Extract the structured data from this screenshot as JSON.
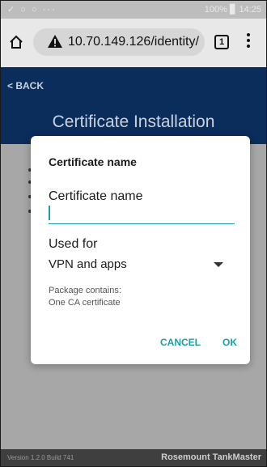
{
  "statusbar": {
    "left": "✓ ○ ○ ···",
    "right": "100% ▊ 14:25"
  },
  "browser": {
    "url": "10.70.149.126/identity/",
    "tab_count": "1",
    "icons": [
      "home-icon",
      "warning-icon",
      "overflow-menu-icon"
    ]
  },
  "app": {
    "back_label": "< BACK",
    "title": "Certificate Installation"
  },
  "dialog": {
    "title": "Certificate name",
    "name_label": "Certificate name",
    "name_value": "",
    "used_for_label": "Used for",
    "used_for_value": "VPN and apps",
    "package_line1": "Package contains:",
    "package_line2": "One CA certificate",
    "cancel_label": "CANCEL",
    "ok_label": "OK"
  },
  "footer": {
    "version": "Version 1.2.0 Build 741",
    "brand": "Rosemount TankMaster"
  },
  "colors": {
    "accent": "#1a9fa8",
    "header": "#0b2d5c",
    "scrim": "#a7a7a7"
  }
}
